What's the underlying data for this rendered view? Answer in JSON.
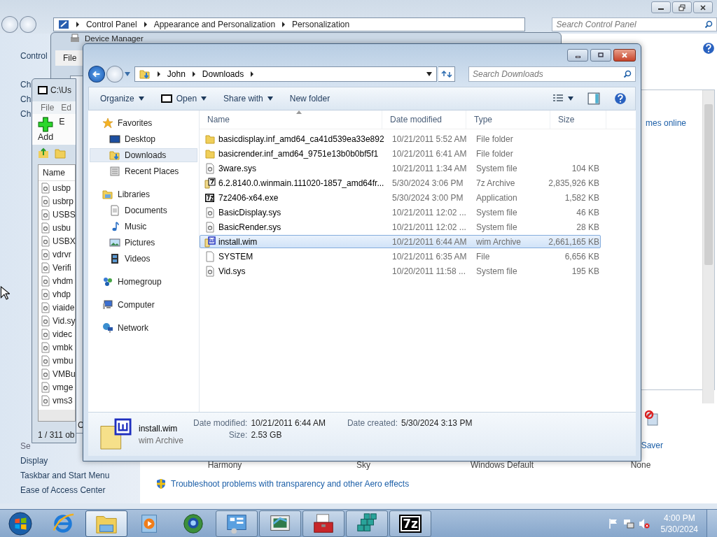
{
  "control_panel": {
    "breadcrumb": [
      "Control Panel",
      "Appearance and Personalization",
      "Personalization"
    ],
    "search": {
      "placeholder": "Search Control Panel"
    },
    "sidebar_top": [
      "Control",
      "Ch",
      "Ch",
      "Ch"
    ],
    "see_also": "Se",
    "sidebar_links": [
      "Display",
      "Taskbar and Start Menu",
      "Ease of Access Center"
    ],
    "get_more_link": "mes online",
    "screen_saver_label": "Saver",
    "themes": [
      "Harmony",
      "Sky",
      "Windows Default",
      "None"
    ],
    "troubleshoot_link": "Troubleshoot problems with transparency and other Aero effects"
  },
  "device_manager": {
    "title": "Device Manager",
    "menu": [
      "File"
    ]
  },
  "sevenzip": {
    "title": "C:\\Us",
    "menu": [
      "File",
      "Ed"
    ],
    "toolbar": [
      "Add",
      "E"
    ],
    "column": "Name",
    "files": [
      "usbp",
      "usbrp",
      "USBS",
      "usbu",
      "USBX",
      "vdrvr",
      "Verifi",
      "vhdm",
      "vhdp",
      "viaide",
      "Vid.sy",
      "videc",
      "vmbk",
      "vmbu",
      "VMBu",
      "vmge",
      "vms3"
    ],
    "status": "1 / 311 ob"
  },
  "hidden_window": {
    "status": "C"
  },
  "explorer": {
    "path": [
      "John",
      "Downloads"
    ],
    "search": {
      "placeholder": "Search Downloads"
    },
    "toolbar": [
      {
        "label": "Organize",
        "dropdown": true,
        "kind": "menu"
      },
      {
        "label": "Open",
        "dropdown": true,
        "kind": "app-menu"
      },
      {
        "label": "Share with",
        "dropdown": true,
        "kind": "menu"
      },
      {
        "label": "New folder",
        "dropdown": false,
        "kind": "command"
      }
    ],
    "nav": [
      {
        "label": "Favorites",
        "kind": "favorites",
        "selected": false,
        "children": [
          {
            "label": "Desktop",
            "kind": "desktop",
            "selected": false
          },
          {
            "label": "Downloads",
            "kind": "downloads",
            "selected": true
          },
          {
            "label": "Recent Places",
            "kind": "recent",
            "selected": false
          }
        ]
      },
      {
        "label": "Libraries",
        "kind": "libraries",
        "selected": false,
        "children": [
          {
            "label": "Documents",
            "kind": "documents",
            "selected": false
          },
          {
            "label": "Music",
            "kind": "music",
            "selected": false
          },
          {
            "label": "Pictures",
            "kind": "pictures",
            "selected": false
          },
          {
            "label": "Videos",
            "kind": "videos",
            "selected": false
          }
        ]
      },
      {
        "label": "Homegroup",
        "kind": "homegroup",
        "selected": false
      },
      {
        "label": "Computer",
        "kind": "computer",
        "selected": false
      },
      {
        "label": "Network",
        "kind": "network",
        "selected": false
      }
    ],
    "columns": [
      "Name",
      "Date modified",
      "Type",
      "Size"
    ],
    "rows": [
      {
        "kind": "folder",
        "name": "basicdisplay.inf_amd64_ca41d539ea33e892",
        "date": "10/21/2011 5:52 AM",
        "type": "File folder",
        "size": "",
        "selected": false
      },
      {
        "kind": "folder",
        "name": "basicrender.inf_amd64_9751e13b0b0bf5f1",
        "date": "10/21/2011 6:41 AM",
        "type": "File folder",
        "size": "",
        "selected": false
      },
      {
        "kind": "sys",
        "name": "3ware.sys",
        "date": "10/21/2011 1:34 AM",
        "type": "System file",
        "size": "104 KB",
        "selected": false
      },
      {
        "kind": "archive",
        "name": "6.2.8140.0.winmain.111020-1857_amd64fr...",
        "date": "5/30/2024 3:06 PM",
        "type": "7z Archive",
        "size": "2,835,926 KB",
        "selected": false
      },
      {
        "kind": "exe",
        "name": "7z2406-x64.exe",
        "date": "5/30/2024 3:00 PM",
        "type": "Application",
        "size": "1,582 KB",
        "selected": false
      },
      {
        "kind": "sys",
        "name": "BasicDisplay.sys",
        "date": "10/21/2011 12:02 ...",
        "type": "System file",
        "size": "46 KB",
        "selected": false
      },
      {
        "kind": "sys",
        "name": "BasicRender.sys",
        "date": "10/21/2011 12:02 ...",
        "type": "System file",
        "size": "28 KB",
        "selected": false
      },
      {
        "kind": "wim",
        "name": "install.wim",
        "date": "10/21/2011 6:44 AM",
        "type": "wim Archive",
        "size": "2,661,165 KB",
        "selected": true
      },
      {
        "kind": "file",
        "name": "SYSTEM",
        "date": "10/21/2011 6:35 AM",
        "type": "File",
        "size": "6,656 KB",
        "selected": false
      },
      {
        "kind": "sys",
        "name": "Vid.sys",
        "date": "10/20/2011 11:58 ...",
        "type": "System file",
        "size": "195 KB",
        "selected": false
      }
    ],
    "details": {
      "name": "install.wim",
      "type": "wim Archive",
      "fields": [
        {
          "label": "Date modified:",
          "value": "10/21/2011 6:44 AM"
        },
        {
          "label": "Size:",
          "value": "2.53 GB"
        },
        {
          "label": "Date created:",
          "value": "5/30/2024 3:13 PM"
        }
      ]
    }
  },
  "taskbar": {
    "items": [
      {
        "kind": "start",
        "open": false,
        "selected": false
      },
      {
        "kind": "browser",
        "open": false,
        "selected": false
      },
      {
        "kind": "folder",
        "open": true,
        "selected": true
      },
      {
        "kind": "media",
        "open": false,
        "selected": false
      },
      {
        "kind": "globe",
        "open": false,
        "selected": false
      },
      {
        "kind": "control-panel",
        "open": true,
        "selected": false
      },
      {
        "kind": "display",
        "open": true,
        "selected": false
      },
      {
        "kind": "toolbox",
        "open": true,
        "selected": false
      },
      {
        "kind": "cubes",
        "open": true,
        "selected": false
      },
      {
        "kind": "sevenzip",
        "label": "7z",
        "open": true,
        "selected": false
      }
    ],
    "time": "4:00 PM",
    "date": "5/30/2024"
  }
}
